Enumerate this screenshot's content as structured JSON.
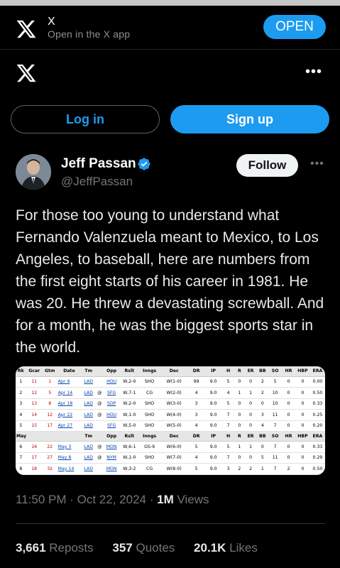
{
  "banner": {
    "title": "X",
    "subtitle": "Open in the X app",
    "open_label": "OPEN"
  },
  "auth": {
    "login_label": "Log in",
    "signup_label": "Sign up"
  },
  "post": {
    "author_name": "Jeff Passan",
    "author_handle": "@JeffPassan",
    "follow_label": "Follow",
    "text": "For those too young to understand what Fernando Valenzuela meant to Mexico, to Los Angeles, to baseball, here are numbers from the first eight starts of his career in 1981. He was 20. He threw a devastating screwball. And for a month, he was the biggest sports star in the world.",
    "time": "11:50 PM",
    "date": "Oct 22, 2024",
    "views_count": "1M",
    "views_label": "Views",
    "reposts_count": "3,661",
    "reposts_label": "Reposts",
    "quotes_count": "357",
    "quotes_label": "Quotes",
    "likes_count": "20.1K",
    "likes_label": "Likes"
  },
  "stats_table": {
    "headers": [
      "Rk",
      "Gcar",
      "Gtm",
      "Date",
      "Tm",
      "",
      "Opp",
      "Rslt",
      "Inngs",
      "Dec",
      "DR",
      "IP",
      "H",
      "R",
      "ER",
      "BB",
      "SO",
      "HR",
      "HBP",
      "ERA"
    ],
    "section_label": "May",
    "section_headers": [
      "Tm",
      "",
      "Opp",
      "Rslt",
      "Inngs",
      "Dec",
      "DR",
      "IP",
      "H",
      "R",
      "ER",
      "BB",
      "SO",
      "HR",
      "HBP",
      "ERA"
    ],
    "rows_april": [
      [
        "1",
        "11",
        "1",
        "Apr 9",
        "LAD",
        "",
        "HOU",
        "W,2-0",
        "SHO",
        "W(1-0)",
        "99",
        "9.0",
        "5",
        "0",
        "0",
        "2",
        "5",
        "0",
        "0",
        "0.00"
      ],
      [
        "2",
        "12",
        "5",
        "Apr 14",
        "LAD",
        "@",
        "SFG",
        "W,7-1",
        "CG",
        "W(2-0)",
        "4",
        "9.0",
        "4",
        "1",
        "1",
        "2",
        "10",
        "0",
        "0",
        "0.50"
      ],
      [
        "3",
        "13",
        "8",
        "Apr 18",
        "LAD",
        "@",
        "SDP",
        "W,2-0",
        "SHO",
        "W(3-0)",
        "3",
        "9.0",
        "5",
        "0",
        "0",
        "0",
        "10",
        "0",
        "0",
        "0.33"
      ],
      [
        "4",
        "14",
        "12",
        "Apr 22",
        "LAD",
        "@",
        "HOU",
        "W,1-0",
        "SHO",
        "W(4-0)",
        "3",
        "9.0",
        "7",
        "0",
        "0",
        "3",
        "11",
        "0",
        "0",
        "0.25"
      ],
      [
        "5",
        "15",
        "17",
        "Apr 27",
        "LAD",
        "",
        "SFG",
        "W,5-0",
        "SHO",
        "W(5-0)",
        "4",
        "9.0",
        "7",
        "0",
        "0",
        "4",
        "7",
        "0",
        "0",
        "0.20"
      ]
    ],
    "rows_may": [
      [
        "6",
        "16",
        "22",
        "May 3",
        "LAD",
        "@",
        "MON",
        "W,6-1",
        "GS-9",
        "W(6-0)",
        "5",
        "9.0",
        "5",
        "1",
        "1",
        "0",
        "7",
        "0",
        "0",
        "0.33"
      ],
      [
        "7",
        "17",
        "27",
        "May 8",
        "LAD",
        "@",
        "NYM",
        "W,1-0",
        "SHO",
        "W(7-0)",
        "4",
        "9.0",
        "7",
        "0",
        "0",
        "5",
        "11",
        "0",
        "0",
        "0.29"
      ],
      [
        "8",
        "18",
        "32",
        "May 14",
        "LAD",
        "",
        "MON",
        "W,3-2",
        "CG",
        "W(8-0)",
        "5",
        "9.0",
        "3",
        "2",
        "2",
        "1",
        "7",
        "2",
        "0",
        "0.50"
      ]
    ]
  },
  "icons": {
    "x_logo": "x-logo-icon",
    "more": "more-dots-icon",
    "verified": "verified-badge-icon"
  },
  "colors": {
    "accent": "#1d9bf0",
    "background": "#000000",
    "muted": "#71767b"
  }
}
